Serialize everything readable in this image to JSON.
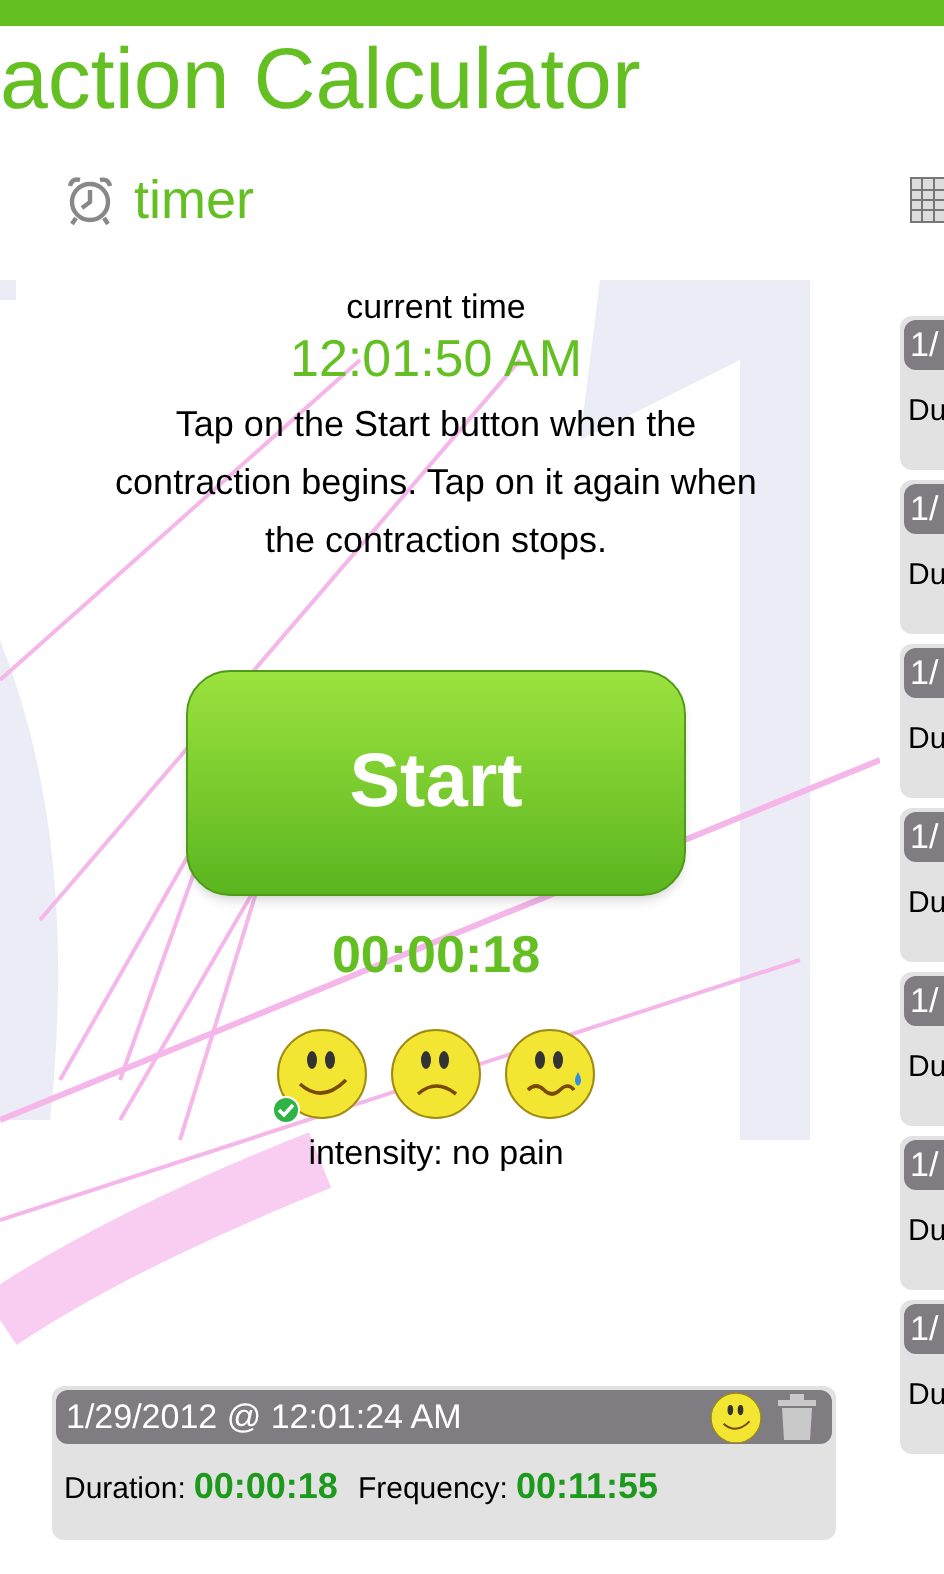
{
  "app_title": "action Calculator",
  "pivot": {
    "label": "timer"
  },
  "current_time": {
    "label": "current time",
    "value": "12:01:50 AM"
  },
  "instructions": "Tap on the Start button when the contraction begins. Tap on it again when the contraction stops.",
  "start_button": "Start",
  "elapsed": "00:00:18",
  "intensities": [
    {
      "kind": "happy",
      "selected": true
    },
    {
      "kind": "sad",
      "selected": false
    },
    {
      "kind": "crying",
      "selected": false
    }
  ],
  "intensity_label": "intensity: no pain",
  "last_record": {
    "date": "1/29/2012 @ 12:01:24 AM",
    "face": {
      "kind": "happy"
    },
    "duration_label": "Duration:",
    "duration": "00:00:18",
    "frequency_label": "Frequency:",
    "frequency": "00:11:55"
  },
  "history": [
    {
      "date": "1/",
      "duration_label": "Du"
    },
    {
      "date": "1/",
      "duration_label": "Du"
    },
    {
      "date": "1/",
      "duration_label": "Du"
    },
    {
      "date": "1/",
      "duration_label": "Du"
    },
    {
      "date": "1/",
      "duration_label": "Du"
    },
    {
      "date": "1/",
      "duration_label": "Du"
    },
    {
      "date": "1/",
      "duration_label": "Du"
    }
  ]
}
